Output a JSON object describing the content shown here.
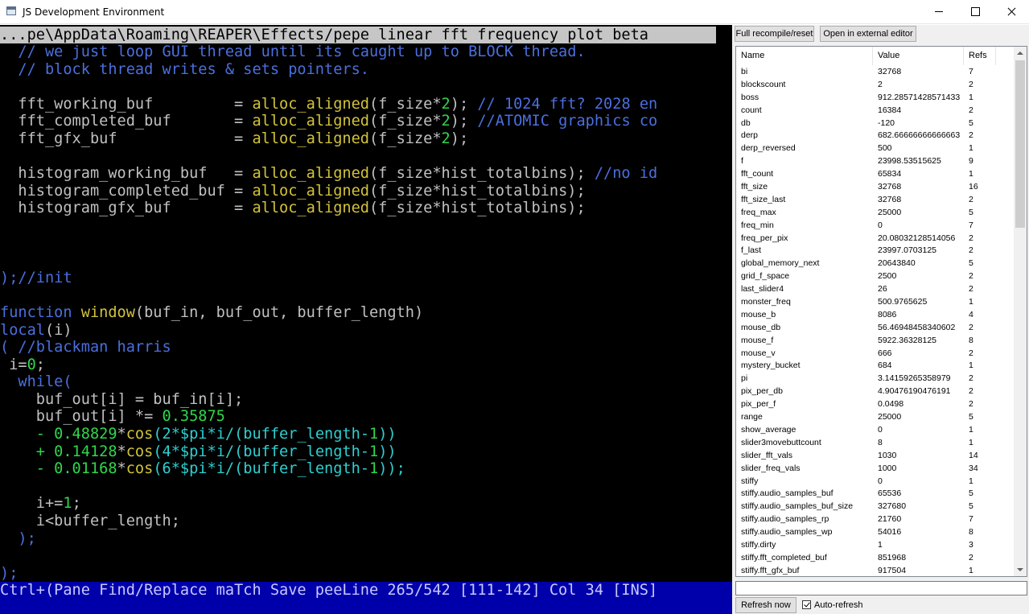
{
  "window": {
    "title": "JS Development Environment"
  },
  "editor": {
    "path": "...pe\\AppData\\Roaming\\REAPER\\Effects/pepe linear fft frequency plot beta",
    "lines": [
      [
        [
          "c-comment",
          "  // we just loop GUI thread until its caught up to BLOCK thread."
        ]
      ],
      [
        [
          "c-comment",
          "  // block thread writes & sets pointers."
        ]
      ],
      [
        [
          "c-default",
          ""
        ]
      ],
      [
        [
          "c-default",
          "  fft_working_buf         = "
        ],
        [
          "c-func",
          "alloc_aligned"
        ],
        [
          "c-default",
          "(f_size*"
        ],
        [
          "c-num",
          "2"
        ],
        [
          "c-default",
          ");"
        ],
        [
          "c-comment",
          " // 1024 fft? 2028 en"
        ]
      ],
      [
        [
          "c-default",
          "  fft_completed_buf       = "
        ],
        [
          "c-func",
          "alloc_aligned"
        ],
        [
          "c-default",
          "(f_size*"
        ],
        [
          "c-num",
          "2"
        ],
        [
          "c-default",
          ");"
        ],
        [
          "c-comment",
          " //ATOMIC graphics co"
        ]
      ],
      [
        [
          "c-default",
          "  fft_gfx_buf             = "
        ],
        [
          "c-func",
          "alloc_aligned"
        ],
        [
          "c-default",
          "(f_size*"
        ],
        [
          "c-num",
          "2"
        ],
        [
          "c-default",
          ");"
        ]
      ],
      [
        [
          "c-default",
          ""
        ]
      ],
      [
        [
          "c-default",
          "  histogram_working_buf   = "
        ],
        [
          "c-func",
          "alloc_aligned"
        ],
        [
          "c-default",
          "(f_size*hist_totalbins);"
        ],
        [
          "c-comment",
          " //no id"
        ]
      ],
      [
        [
          "c-default",
          "  histogram_completed_buf = "
        ],
        [
          "c-func",
          "alloc_aligned"
        ],
        [
          "c-default",
          "(f_size*hist_totalbins);"
        ]
      ],
      [
        [
          "c-default",
          "  histogram_gfx_buf       = "
        ],
        [
          "c-func",
          "alloc_aligned"
        ],
        [
          "c-default",
          "(f_size*hist_totalbins);"
        ]
      ],
      [
        [
          "c-default",
          ""
        ]
      ],
      [
        [
          "c-default",
          ""
        ]
      ],
      [
        [
          "c-default",
          ""
        ]
      ],
      [
        [
          "c-kw",
          ");"
        ],
        [
          "c-comment",
          "//init"
        ]
      ],
      [
        [
          "c-default",
          ""
        ]
      ],
      [
        [
          "c-kw",
          "function "
        ],
        [
          "c-func",
          "window"
        ],
        [
          "c-default",
          "(buf_in, buf_out, buffer_length)"
        ]
      ],
      [
        [
          "c-kw",
          "local"
        ],
        [
          "c-default",
          "(i)"
        ]
      ],
      [
        [
          "c-kw",
          "( "
        ],
        [
          "c-comment",
          "//blackman harris"
        ]
      ],
      [
        [
          "c-default",
          " i="
        ],
        [
          "c-num",
          "0"
        ],
        [
          "c-default",
          ";"
        ]
      ],
      [
        [
          "c-kw",
          "  while("
        ]
      ],
      [
        [
          "c-default",
          "    buf_out[i] = buf_in[i];"
        ]
      ],
      [
        [
          "c-default",
          "    buf_out[i] *= "
        ],
        [
          "c-num",
          "0.35875"
        ]
      ],
      [
        [
          "c-num",
          "    - 0.48829"
        ],
        [
          "c-default",
          "*"
        ],
        [
          "c-func",
          "cos"
        ],
        [
          "c-cyan",
          "(2*$pi*i/(buffer_length-"
        ],
        [
          "c-num",
          "1"
        ],
        [
          "c-cyan",
          "))"
        ]
      ],
      [
        [
          "c-num",
          "    + 0.14128"
        ],
        [
          "c-default",
          "*"
        ],
        [
          "c-func",
          "cos"
        ],
        [
          "c-cyan",
          "(4*$pi*i/(buffer_length-"
        ],
        [
          "c-num",
          "1"
        ],
        [
          "c-cyan",
          "))"
        ]
      ],
      [
        [
          "c-num",
          "    - 0.01168"
        ],
        [
          "c-default",
          "*"
        ],
        [
          "c-func",
          "cos"
        ],
        [
          "c-cyan",
          "(6*$pi*i/(buffer_length-"
        ],
        [
          "c-num",
          "1"
        ],
        [
          "c-cyan",
          "));"
        ]
      ],
      [
        [
          "c-default",
          ""
        ]
      ],
      [
        [
          "c-default",
          "    i+="
        ],
        [
          "c-num",
          "1"
        ],
        [
          "c-default",
          ";"
        ]
      ],
      [
        [
          "c-default",
          "    i<buffer_length;"
        ]
      ],
      [
        [
          "c-kw",
          "  );"
        ]
      ],
      [
        [
          "c-default",
          ""
        ]
      ],
      [
        [
          "c-kw",
          ");"
        ]
      ]
    ],
    "status": "Ctrl+(Pane Find/Replace maTch Save peeLine 265/542 [111-142] Col 34 [INS]"
  },
  "toolbar": {
    "recompile_label": "Full recompile/reset",
    "external_label": "Open in external editor"
  },
  "vars": {
    "headers": {
      "name": "Name",
      "value": "Value",
      "refs": "Refs"
    },
    "rows": [
      {
        "name": "bi",
        "value": "32768",
        "refs": "7"
      },
      {
        "name": "blockscount",
        "value": "2",
        "refs": "2"
      },
      {
        "name": "boss",
        "value": "912.28571428571433",
        "refs": "1"
      },
      {
        "name": "count",
        "value": "16384",
        "refs": "2"
      },
      {
        "name": "db",
        "value": "-120",
        "refs": "5"
      },
      {
        "name": "derp",
        "value": "682.66666666666663",
        "refs": "2"
      },
      {
        "name": "derp_reversed",
        "value": "500",
        "refs": "1"
      },
      {
        "name": "f",
        "value": "23998.53515625",
        "refs": "9"
      },
      {
        "name": "fft_count",
        "value": "65834",
        "refs": "1"
      },
      {
        "name": "fft_size",
        "value": "32768",
        "refs": "16"
      },
      {
        "name": "fft_size_last",
        "value": "32768",
        "refs": "2"
      },
      {
        "name": "freq_max",
        "value": "25000",
        "refs": "5"
      },
      {
        "name": "freq_min",
        "value": "0",
        "refs": "7"
      },
      {
        "name": "freq_per_pix",
        "value": "20.08032128514056",
        "refs": "2"
      },
      {
        "name": "f_last",
        "value": "23997.0703125",
        "refs": "2"
      },
      {
        "name": "global_memory_next",
        "value": "20643840",
        "refs": "5"
      },
      {
        "name": "grid_f_space",
        "value": "2500",
        "refs": "2"
      },
      {
        "name": "last_slider4",
        "value": "26",
        "refs": "2"
      },
      {
        "name": "monster_freq",
        "value": "500.9765625",
        "refs": "1"
      },
      {
        "name": "mouse_b",
        "value": "8086",
        "refs": "4"
      },
      {
        "name": "mouse_db",
        "value": "56.46948458340602",
        "refs": "2"
      },
      {
        "name": "mouse_f",
        "value": "5922.36328125",
        "refs": "8"
      },
      {
        "name": "mouse_v",
        "value": "666",
        "refs": "2"
      },
      {
        "name": "mystery_bucket",
        "value": "684",
        "refs": "1"
      },
      {
        "name": "pi",
        "value": "3.14159265358979",
        "refs": "2"
      },
      {
        "name": "pix_per_db",
        "value": "4.90476190476191",
        "refs": "2"
      },
      {
        "name": "pix_per_f",
        "value": "0.0498",
        "refs": "2"
      },
      {
        "name": "range",
        "value": "25000",
        "refs": "5"
      },
      {
        "name": "show_average",
        "value": "0",
        "refs": "1"
      },
      {
        "name": "slider3movebuttcount",
        "value": "8",
        "refs": "1"
      },
      {
        "name": "slider_fft_vals",
        "value": "1030",
        "refs": "14"
      },
      {
        "name": "slider_freq_vals",
        "value": "1000",
        "refs": "34"
      },
      {
        "name": "stiffy",
        "value": "0",
        "refs": "1"
      },
      {
        "name": "stiffy.audio_samples_buf",
        "value": "65536",
        "refs": "5"
      },
      {
        "name": "stiffy.audio_samples_buf_size",
        "value": "327680",
        "refs": "5"
      },
      {
        "name": "stiffy.audio_samples_rp",
        "value": "21760",
        "refs": "7"
      },
      {
        "name": "stiffy.audio_samples_wp",
        "value": "54016",
        "refs": "8"
      },
      {
        "name": "stiffy.dirty",
        "value": "1",
        "refs": "3"
      },
      {
        "name": "stiffy.fft_completed_buf",
        "value": "851968",
        "refs": "2"
      },
      {
        "name": "stiffy.fft_gfx_buf",
        "value": "917504",
        "refs": "1"
      }
    ]
  },
  "bottom": {
    "filter_value": "",
    "refresh_label": "Refresh now",
    "autorefresh_label": "Auto-refresh",
    "autorefresh_checked": true
  }
}
